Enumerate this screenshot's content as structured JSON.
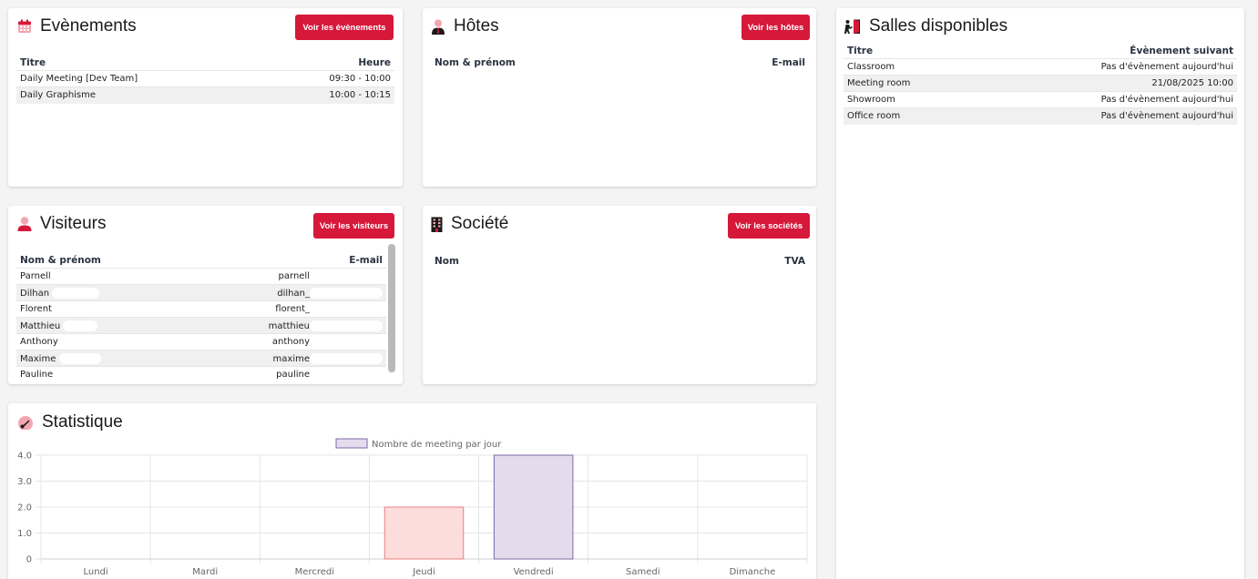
{
  "events": {
    "title": "Evènements",
    "button": "Voir les évènements",
    "col_title": "Titre",
    "col_time": "Heure",
    "rows": [
      {
        "title": "Daily Meeting [Dev Team]",
        "time": "09:30 - 10:00"
      },
      {
        "title": "Daily Graphisme",
        "time": "10:00 - 10:15"
      }
    ]
  },
  "hosts": {
    "title": "Hôtes",
    "button": "Voir les hôtes",
    "col_name": "Nom & prénom",
    "col_email": "E-mail"
  },
  "rooms": {
    "title": "Salles disponibles",
    "col_title": "Titre",
    "col_next": "Évènement suivant",
    "rows": [
      {
        "name": "Classroom",
        "next": "Pas d'évènement aujourd'hui"
      },
      {
        "name": "Meeting room",
        "next": "21/08/2025 10:00"
      },
      {
        "name": "Showroom",
        "next": "Pas d'évènement aujourd'hui"
      },
      {
        "name": "Office room",
        "next": "Pas d'évènement aujourd'hui"
      }
    ]
  },
  "visitors": {
    "title": "Visiteurs",
    "button": "Voir les visiteurs",
    "col_name": "Nom & prénom",
    "col_email": "E-mail",
    "rows": [
      {
        "name": "Parnell",
        "email": "parnell"
      },
      {
        "name": "Dilhan",
        "email": "dilhan_"
      },
      {
        "name": "Florent",
        "email": "florent_"
      },
      {
        "name": "Matthieu",
        "email": "matthieu"
      },
      {
        "name": "Anthony",
        "email": "anthony"
      },
      {
        "name": "Maxime",
        "email": "maxime"
      },
      {
        "name": "Pauline",
        "email": "pauline"
      }
    ]
  },
  "companies": {
    "title": "Société",
    "button": "Voir les sociétés",
    "col_name": "Nom",
    "col_vat": "TVA"
  },
  "stats": {
    "title": "Statistique"
  },
  "icons": {
    "events": "calendar-icon",
    "hosts": "user-tie-icon",
    "rooms": "door-open-icon",
    "visitors": "user-icon",
    "companies": "building-icon",
    "stats": "gauge-icon"
  },
  "colors": {
    "accent": "#d6183a",
    "bar_jeudi_fill": "#fddcdc",
    "bar_jeudi_stroke": "#e8807f",
    "bar_vendredi_fill": "#e4dcec",
    "bar_vendredi_stroke": "#7b68a6"
  },
  "chart_data": {
    "type": "bar",
    "categories": [
      "Lundi",
      "Mardi",
      "Mercredi",
      "Jeudi",
      "Vendredi",
      "Samedi",
      "Dimanche"
    ],
    "series": [
      {
        "name": "Nombre de meeting par jour",
        "values": [
          0,
          0,
          0,
          2,
          4,
          0,
          0
        ]
      }
    ],
    "yticks": [
      "0",
      "1.0",
      "2.0",
      "3.0",
      "4.0"
    ],
    "ylim": [
      0,
      4
    ],
    "grid": true,
    "legend": "top"
  }
}
